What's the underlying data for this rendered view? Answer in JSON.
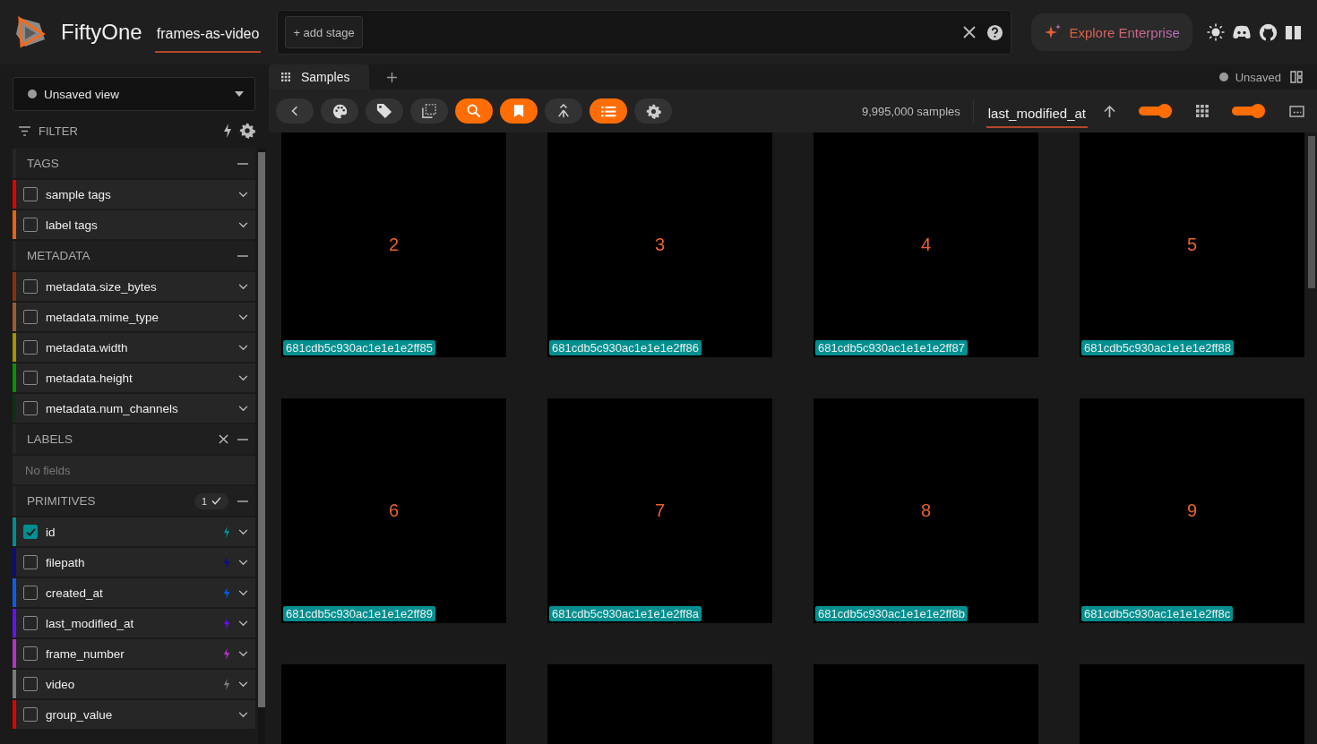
{
  "header": {
    "brand": "FiftyOne",
    "dataset": "frames-as-video",
    "add_stage": "+ add stage",
    "enterprise": "Explore Enterprise"
  },
  "sidebar": {
    "view": "Unsaved view",
    "filter_label": "FILTER",
    "sections": [
      {
        "title": "TAGS",
        "clearable": false,
        "items": [
          {
            "name": "sample tags",
            "color": "#e00000",
            "checked": false,
            "indexed": false
          },
          {
            "name": "label tags",
            "color": "#e8640c",
            "checked": false,
            "indexed": false
          }
        ]
      },
      {
        "title": "METADATA",
        "clearable": false,
        "items": [
          {
            "name": "metadata.size_bytes",
            "color": "#8a3008",
            "checked": false,
            "indexed": false
          },
          {
            "name": "metadata.mime_type",
            "color": "#a05a32",
            "checked": false,
            "indexed": false
          },
          {
            "name": "metadata.width",
            "color": "#a09400",
            "checked": false,
            "indexed": false
          },
          {
            "name": "metadata.height",
            "color": "#009400",
            "checked": false,
            "indexed": false
          },
          {
            "name": "metadata.num_channels",
            "color": "#0e320e",
            "checked": false,
            "indexed": false
          }
        ]
      },
      {
        "title": "LABELS",
        "clearable": true,
        "empty": "No fields"
      },
      {
        "title": "PRIMITIVES",
        "clearable": false,
        "badge": "1",
        "items": [
          {
            "name": "id",
            "color": "#008f8f",
            "checked": true,
            "indexed": true
          },
          {
            "name": "filepath",
            "color": "#0a0a8c",
            "checked": false,
            "indexed": true
          },
          {
            "name": "created_at",
            "color": "#0a5cf0",
            "checked": false,
            "indexed": true
          },
          {
            "name": "last_modified_at",
            "color": "#6412f0",
            "checked": false,
            "indexed": true
          },
          {
            "name": "frame_number",
            "color": "#b432c8",
            "checked": false,
            "indexed": true
          },
          {
            "name": "video",
            "color": "#7a7a7a",
            "checked": false,
            "indexed": true
          },
          {
            "name": "group_value",
            "color": "#e00000",
            "checked": false,
            "indexed": false
          }
        ]
      }
    ]
  },
  "tabs": [
    {
      "label": "Samples",
      "selected": true
    }
  ],
  "view_status": "Unsaved",
  "toolbar": [
    {
      "kind": "back",
      "active": false
    },
    {
      "kind": "palette",
      "active": false
    },
    {
      "kind": "tag",
      "active": false
    },
    {
      "kind": "select",
      "active": false
    },
    {
      "kind": "search",
      "active": true
    },
    {
      "kind": "bookmark",
      "active": true
    },
    {
      "kind": "merge",
      "active": false
    },
    {
      "kind": "list",
      "active": true
    },
    {
      "kind": "settings",
      "active": false
    }
  ],
  "sample_count": "9,995,000 samples",
  "sort_field": "last_modified_at",
  "sliders": [
    {
      "level": 0.75
    },
    {
      "level": 0.75
    }
  ],
  "samples": [
    {
      "kind": "sample",
      "number": "2",
      "id": "681cdb5c930ac1e1e1e2ff85"
    },
    {
      "kind": "sample",
      "number": "3",
      "id": "681cdb5c930ac1e1e1e2ff86"
    },
    {
      "kind": "sample",
      "number": "4",
      "id": "681cdb5c930ac1e1e1e2ff87"
    },
    {
      "kind": "sample",
      "number": "5",
      "id": "681cdb5c930ac1e1e1e2ff88"
    },
    {
      "kind": "sample",
      "number": "6",
      "id": "681cdb5c930ac1e1e1e2ff89"
    },
    {
      "kind": "sample",
      "number": "7",
      "id": "681cdb5c930ac1e1e1e2ff8a"
    },
    {
      "kind": "sample",
      "number": "8",
      "id": "681cdb5c930ac1e1e1e2ff8b"
    },
    {
      "kind": "sample",
      "number": "9",
      "id": "681cdb5c930ac1e1e1e2ff8c"
    },
    {
      "kind": "blank"
    },
    {
      "kind": "blank"
    },
    {
      "kind": "blank"
    },
    {
      "kind": "blank"
    }
  ]
}
